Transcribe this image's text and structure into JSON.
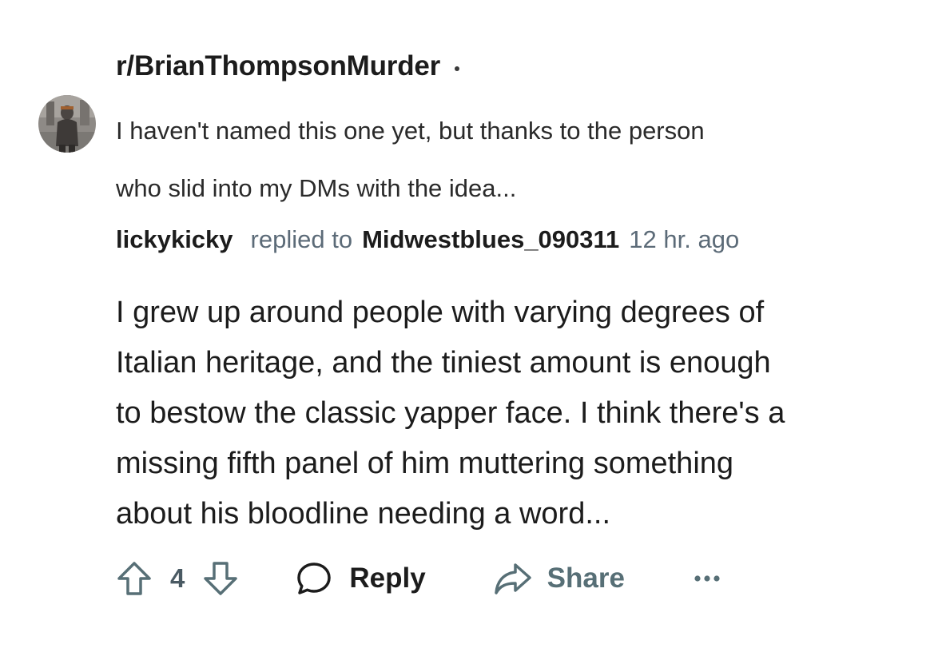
{
  "post": {
    "subreddit": "r/BrianThompsonMurder",
    "title_lines": [
      "I haven't named this one yet, but thanks to the person",
      "who slid into my DMs with the idea..."
    ]
  },
  "reply_meta": {
    "author": "lickykicky",
    "replied_to_label": "replied to",
    "target_user": "Midwestblues_090311",
    "time": "12 hr. ago"
  },
  "comment": {
    "lines": [
      "I grew up around people with varying degrees of",
      "Italian heritage, and the tiniest amount is enough",
      "to bestow the classic yapper face. I think there's a",
      "missing fifth panel of him muttering something",
      "about his bloodline needing a word..."
    ]
  },
  "actions": {
    "vote_count": "4",
    "reply_label": "Reply",
    "share_label": "Share"
  },
  "icons": {
    "upvote": "arrow-up-outline-icon",
    "downvote": "arrow-down-outline-icon",
    "reply": "speech-bubble-icon",
    "share": "share-arrow-icon",
    "more": "ellipsis-icon"
  },
  "colors": {
    "text_primary": "#1c1c1c",
    "text_secondary": "#5c6b78",
    "icon": "#576f76"
  }
}
